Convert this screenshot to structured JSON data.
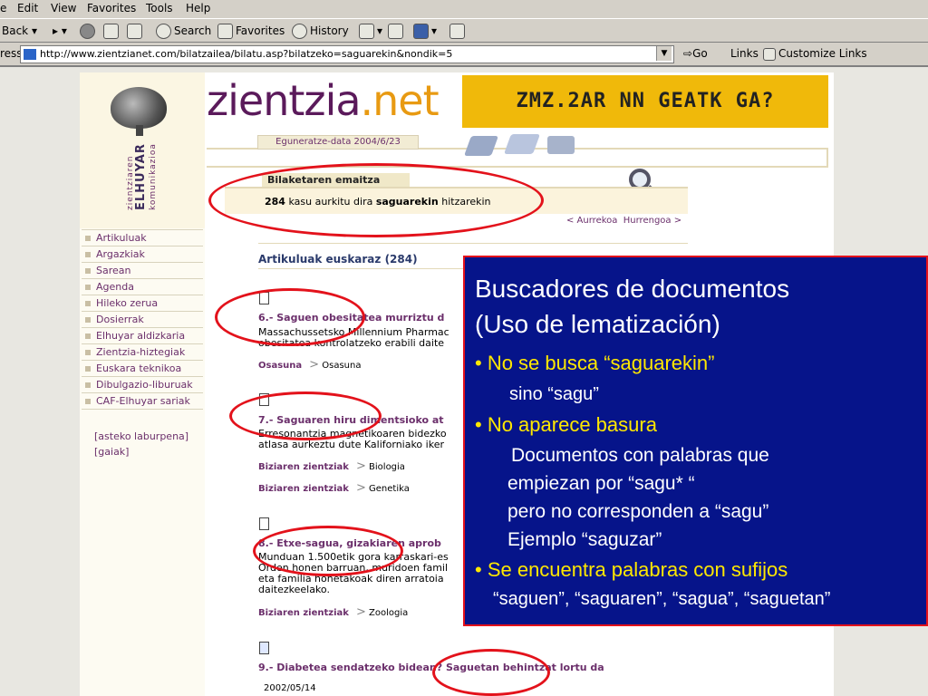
{
  "browser": {
    "menu": [
      "e",
      "Edit",
      "View",
      "Favorites",
      "Tools",
      "Help"
    ],
    "toolbar": {
      "back": "Back",
      "search": "Search",
      "favorites": "Favorites",
      "history": "History"
    },
    "address_label": "ress",
    "url": "http://www.zientzianet.com/bilatzailea/bilatu.asp?bilatzeko=saguarekin&nondik=5",
    "go": "Go",
    "links": "Links",
    "customize_links": "Customize Links"
  },
  "site": {
    "brand_left": "zientzia",
    "brand_right": ".net",
    "logo_line1": "zientziaren",
    "logo_line2": "ELHUYAR",
    "logo_line3": "komunikazioa",
    "banner_text": "ZMZ.2AR NN GEATK GA?",
    "update_date": "Eguneratze-data 2004/6/23",
    "nav": [
      "Artikuluak",
      "Argazkiak",
      "Sarean",
      "Agenda",
      "Hileko zerua",
      "Dosierrak",
      "Elhuyar aldizkaria",
      "Zientzia-hiztegiak",
      "Euskara teknikoa",
      "Dibulgazio-liburuak",
      "CAF-Elhuyar sariak"
    ],
    "side_links": [
      "[asteko laburpena]",
      "[gaiak]"
    ]
  },
  "results": {
    "tab_label": "Bilaketaren emaitza",
    "count": "284",
    "summary_mid": " kasu aurkitu dira ",
    "term": "saguarekin",
    "summary_end": " hitzarekin",
    "prev": "< Aurrekoa",
    "next": "Hurrengoa >",
    "section": "Artikuluak euskaraz (284)",
    "items": [
      {
        "title": "6.- Saguen obesitatea murriztu d",
        "snippet1": "Massachussetsko Millennium Pharmac",
        "snippet2": "obesitatea kontrolatzeko erabili daite",
        "cats": [
          {
            "main": "Osasuna",
            "sub": "Osasuna"
          }
        ]
      },
      {
        "title": "7.- Saguaren hiru dimentsioko at",
        "snippet1": "Erresonantzia magnetikoaren bidezko",
        "snippet2": "atlasa aurkeztu dute Kaliforniako iker",
        "cats": [
          {
            "main": "Biziaren zientziak",
            "sub": "Biologia"
          },
          {
            "main": "Biziaren zientziak",
            "sub": "Genetika"
          }
        ]
      },
      {
        "title": "8.- Etxe-sagua, gizakiaren aprob",
        "snippet1": "Munduan 1.500etik gora karraskari-es",
        "snippet2": "Orden honen barruan, muridoen famil",
        "snippet3": "eta familia honetakoak diren arratoia",
        "snippet4": "daitezkeelako.",
        "cats": [
          {
            "main": "Biziaren zientziak",
            "sub": "Zoologia"
          }
        ]
      },
      {
        "title": "9.- Diabetea sendatzeko bidean? Saguetan behintzat lortu da",
        "date": "2002/05/14"
      }
    ]
  },
  "overlay": {
    "title1": "Buscadores de documentos",
    "title2": "(Uso de lematización)",
    "b1": "• No se busca “saguarekin”",
    "b1_sub": "sino “sagu”",
    "b2": "• No aparece basura",
    "b2_l1": "Documentos con palabras que",
    "b2_l2": "empiezan por “sagu* “",
    "b2_l3": "pero no corresponden a  “sagu”",
    "b2_l4": "Ejemplo “saguzar”",
    "b3": "• Se encuentra palabras con sufijos",
    "b3_sub": "“saguen”, “saguaren”, “sagua”, “saguetan”"
  }
}
